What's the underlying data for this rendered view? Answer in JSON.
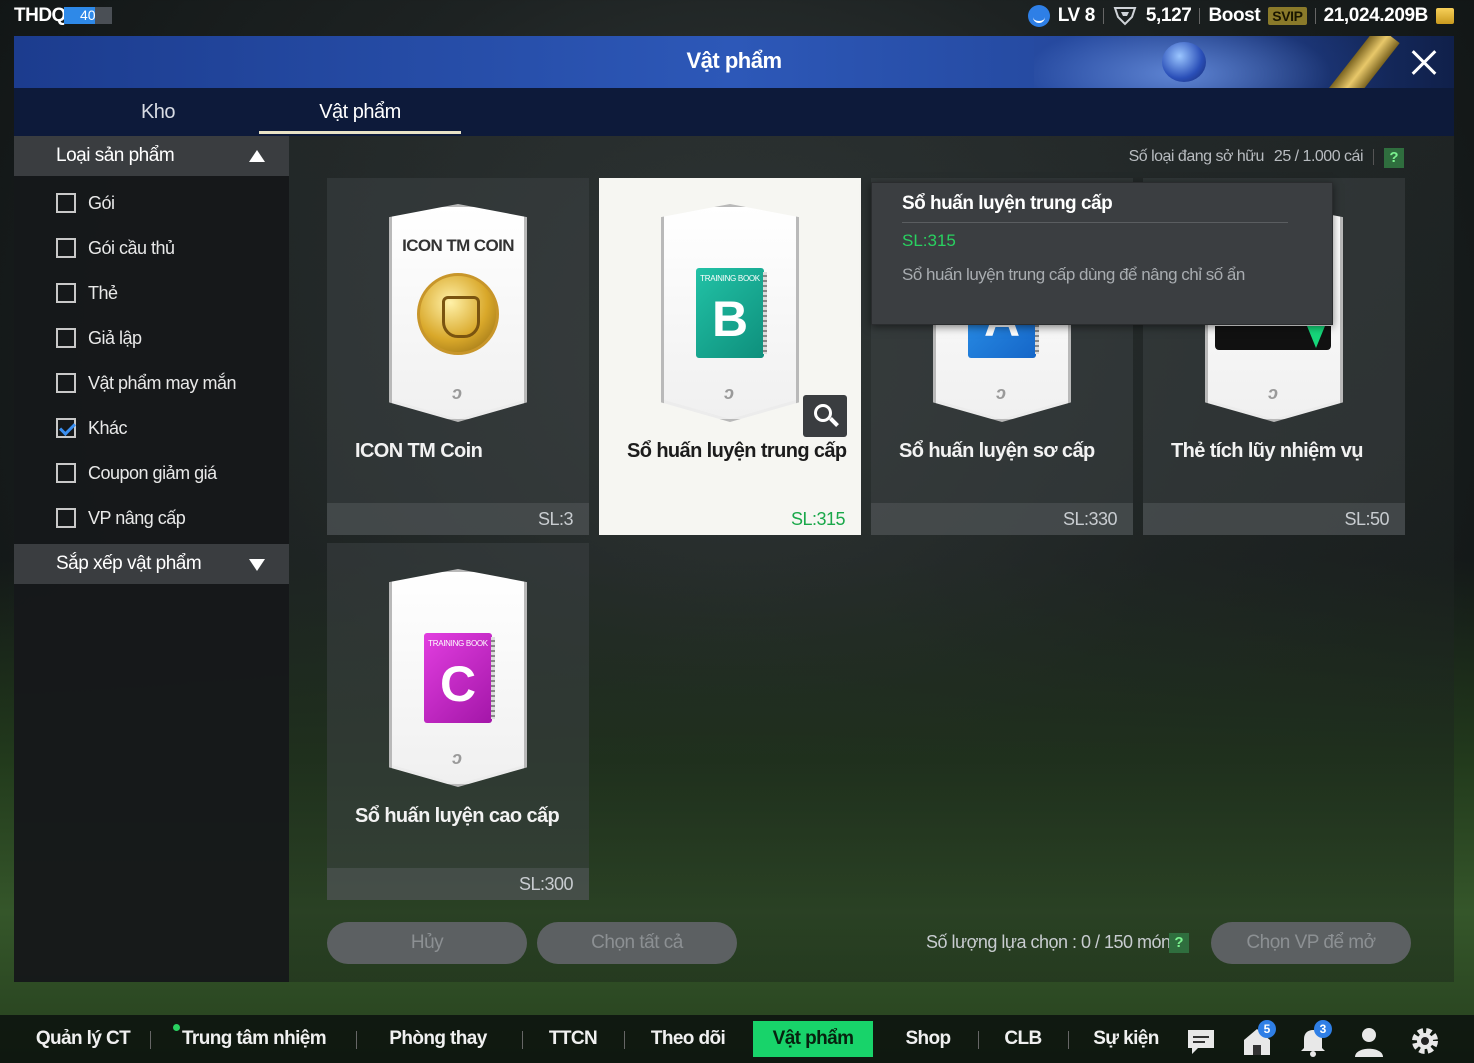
{
  "topbar": {
    "user_id": "THDQ",
    "level_num": "40",
    "level_progress": 0.65,
    "lv": "LV 8",
    "trophies": "5,127",
    "boost": "Boost",
    "svip": "SVIP",
    "currency": "21,024.209B"
  },
  "window": {
    "title": "Vật phẩm"
  },
  "tabs": [
    {
      "label": "Kho"
    },
    {
      "label": "Vật phẩm"
    }
  ],
  "sidebar": {
    "filter_title": "Loại sản phẩm",
    "filters": [
      {
        "label": "Gói",
        "checked": false
      },
      {
        "label": "Gói cầu thủ",
        "checked": false
      },
      {
        "label": "Thẻ",
        "checked": false
      },
      {
        "label": "Giả lập",
        "checked": false
      },
      {
        "label": "Vật phẩm may mắn",
        "checked": false
      },
      {
        "label": "Khác",
        "checked": true
      },
      {
        "label": "Coupon giảm giá",
        "checked": false
      },
      {
        "label": "VP nâng cấp",
        "checked": false
      }
    ],
    "sort_title": "Sắp xếp vật phẩm"
  },
  "inventory": {
    "owned_label": "Số loại đang sở hữu",
    "owned_value": "25 / 1.000 cái",
    "help": "?"
  },
  "items": [
    {
      "name": "ICON TM Coin",
      "qty": "SL:3",
      "art_title": "ICON TM COIN"
    },
    {
      "name": "Sổ huấn luyện trung cấp",
      "qty": "SL:315",
      "book_label": "TRAINING BOOK",
      "book_letter": "B"
    },
    {
      "name": "Sổ huấn luyện sơ cấp",
      "qty": "SL:330",
      "book_letter": "A"
    },
    {
      "name": "Thẻ tích lũy nhiệm vụ",
      "qty": "SL:50"
    },
    {
      "name": "Sổ huấn luyện cao cấp",
      "qty": "SL:300",
      "book_label": "TRAINING BOOK",
      "book_letter": "C"
    }
  ],
  "tooltip": {
    "title": "Sổ huấn luyện trung cấp",
    "qty": "SL:315",
    "desc": "Sổ huấn luyện trung cấp dùng để nâng chỉ số ẩn"
  },
  "actions": {
    "cancel": "Hủy",
    "select_all": "Chọn tất cả",
    "selection_count": "Số lượng lựa chọn : 0 / 150 món",
    "help": "?",
    "open": "Chọn VP để mở"
  },
  "bottom_nav": [
    {
      "label": "Quản lý CT"
    },
    {
      "label": "Trung tâm nhiệm vụ"
    },
    {
      "label": "Phòng thay đồ"
    },
    {
      "label": "TTCN"
    },
    {
      "label": "Theo dõi"
    },
    {
      "label": "Vật phẩm"
    },
    {
      "label": "Shop"
    },
    {
      "label": "CLB"
    },
    {
      "label": "Sự kiện"
    }
  ],
  "badges": {
    "home": "5",
    "bell": "3"
  },
  "icons": [
    "chat-icon",
    "home-icon",
    "bell-icon",
    "profile-icon",
    "gear-icon"
  ]
}
